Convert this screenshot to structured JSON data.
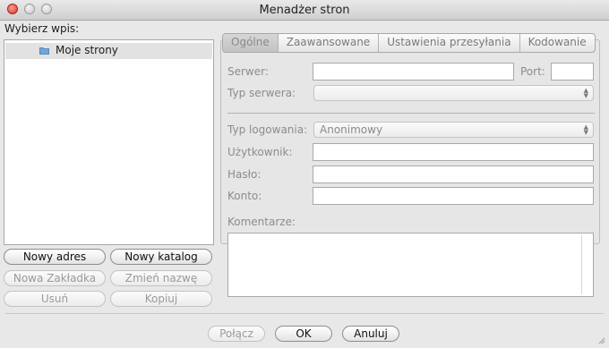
{
  "window": {
    "title": "Menadżer stron"
  },
  "sidebar": {
    "label": "Wybierz wpis:",
    "tree": {
      "item": "Moje strony"
    },
    "buttons": {
      "new_address": "Nowy adres",
      "new_folder": "Nowy katalog",
      "new_bookmark": "Nowa Zakładka",
      "rename": "Zmień nazwę",
      "delete": "Usuń",
      "copy": "Kopiuj"
    }
  },
  "tabs": [
    "Ogólne",
    "Zaawansowane",
    "Ustawienia przesyłania",
    "Kodowanie"
  ],
  "general": {
    "server_label": "Serwer:",
    "port_label": "Port:",
    "server_type_label": "Typ serwera:",
    "logon_type_label": "Typ logowania:",
    "logon_type_value": "Anonimowy",
    "user_label": "Użytkownik:",
    "password_label": "Hasło:",
    "account_label": "Konto:",
    "comments_label": "Komentarze:"
  },
  "footer": {
    "connect": "Połącz",
    "ok": "OK",
    "cancel": "Anuluj"
  }
}
